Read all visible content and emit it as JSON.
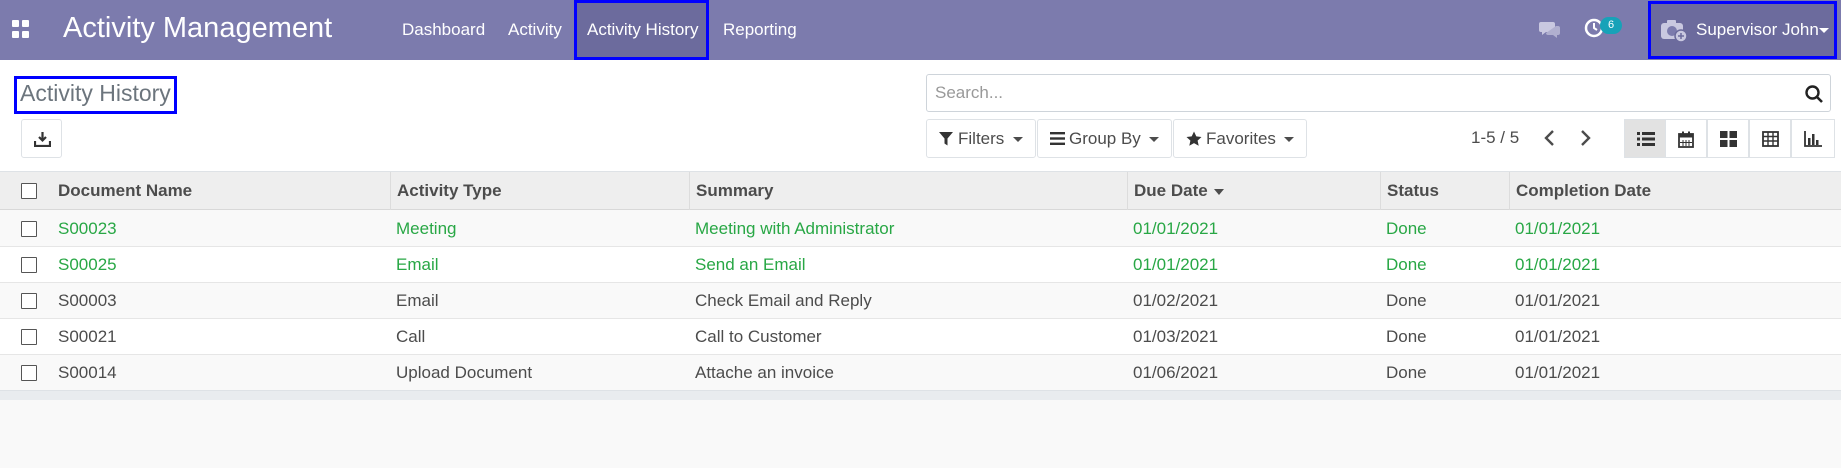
{
  "navbar": {
    "brand": "Activity Management",
    "menu": [
      {
        "label": "Dashboard"
      },
      {
        "label": "Activity"
      },
      {
        "label": "Activity History"
      },
      {
        "label": "Reporting"
      }
    ],
    "activity_badge": "6",
    "user_name": "Supervisor John",
    "color": "#7c7bad"
  },
  "control_panel": {
    "title": "Activity History",
    "search_placeholder": "Search...",
    "filters_label": "Filters",
    "groupby_label": "Group By",
    "favorites_label": "Favorites",
    "pager": "1-5 / 5",
    "views": [
      "list-icon",
      "calendar-icon",
      "kanban-icon",
      "pivot-icon",
      "graph-icon"
    ]
  },
  "table": {
    "columns": [
      "Document Name",
      "Activity Type",
      "Summary",
      "Due Date",
      "Status",
      "Completion Date"
    ],
    "rows": [
      {
        "doc": "S00023",
        "type": "Meeting",
        "summary": "Meeting with Administrator",
        "due": "01/01/2021",
        "status": "Done",
        "completed": "01/01/2021",
        "color": "#28a745"
      },
      {
        "doc": "S00025",
        "type": "Email",
        "summary": "Send an Email",
        "due": "01/01/2021",
        "status": "Done",
        "completed": "01/01/2021",
        "color": "#28a745"
      },
      {
        "doc": "S00003",
        "type": "Email",
        "summary": "Check Email and Reply",
        "due": "01/02/2021",
        "status": "Done",
        "completed": "01/01/2021",
        "color": "#4c4c4c"
      },
      {
        "doc": "S00021",
        "type": "Call",
        "summary": "Call to Customer",
        "due": "01/03/2021",
        "status": "Done",
        "completed": "01/01/2021",
        "color": "#4c4c4c"
      },
      {
        "doc": "S00014",
        "type": "Upload Document",
        "summary": "Attache an invoice",
        "due": "01/06/2021",
        "status": "Done",
        "completed": "01/01/2021",
        "color": "#4c4c4c"
      }
    ]
  }
}
